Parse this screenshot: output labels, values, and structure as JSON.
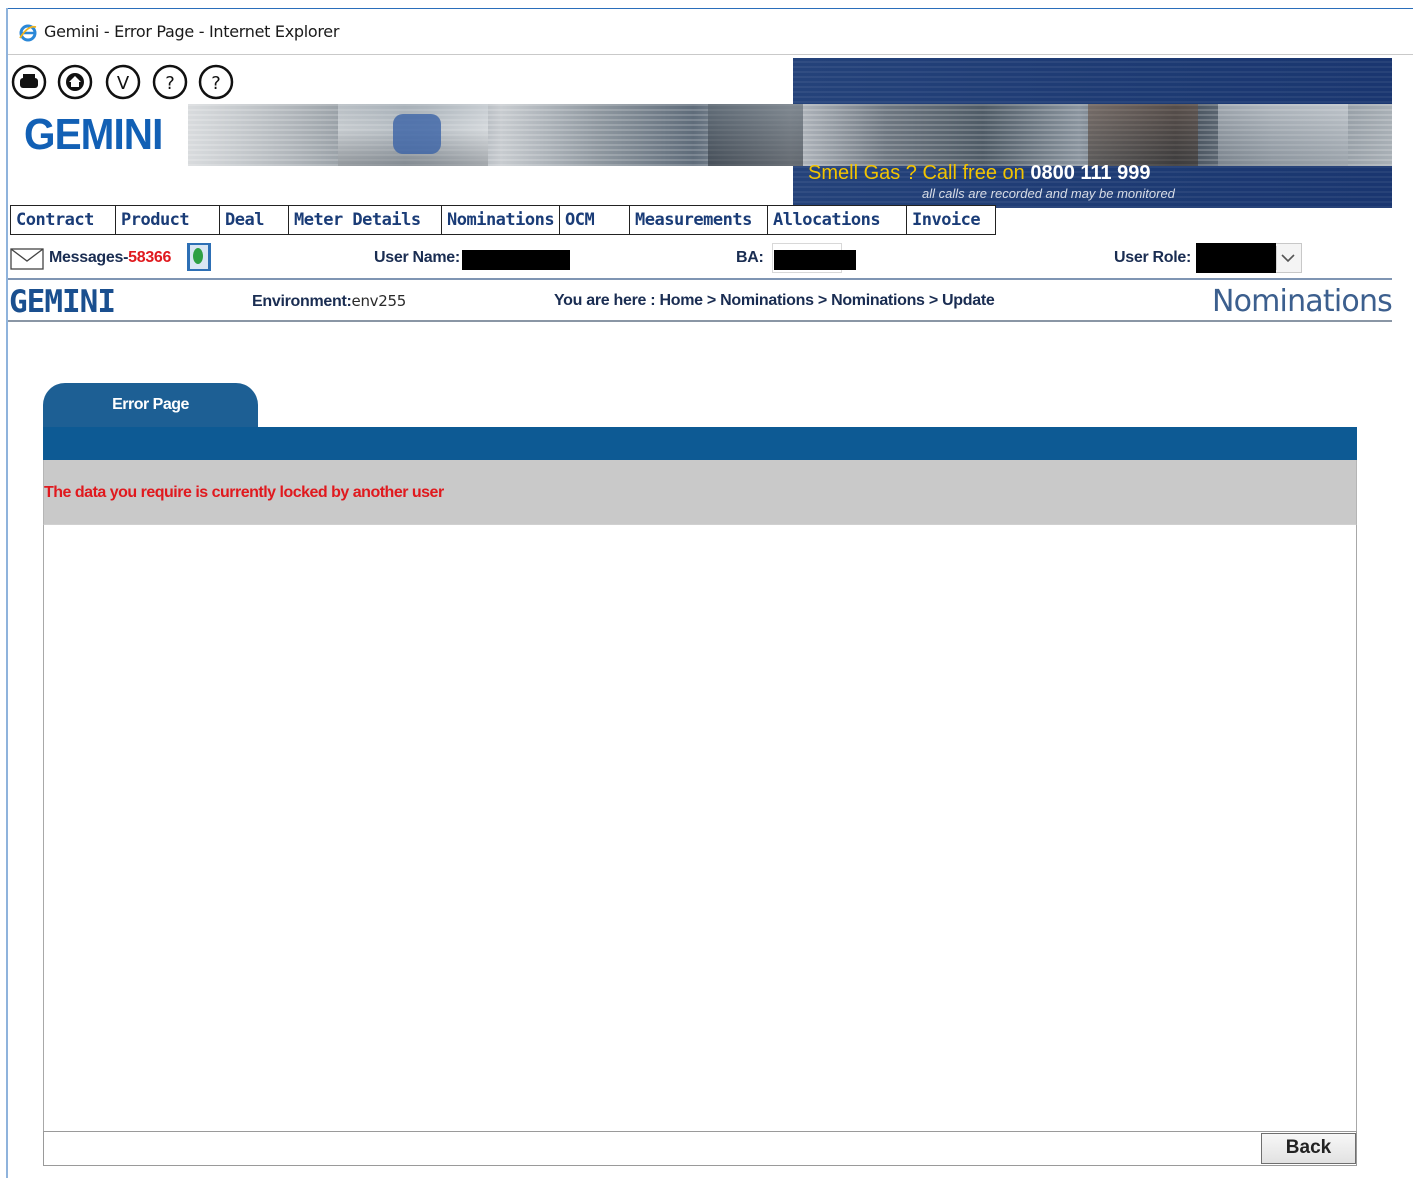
{
  "window": {
    "title": "Gemini - Error Page - Internet Explorer"
  },
  "header": {
    "logo_text": "GEMINI",
    "banner": {
      "smell_gas": "Smell Gas ? Call free on",
      "phone": "0800 111 999",
      "recorded_notice": "all calls are recorded and may be monitored"
    },
    "toolbar_icons": [
      "print-icon",
      "home-icon",
      "version-icon",
      "help-icon",
      "help-icon"
    ]
  },
  "main_nav": {
    "items": [
      {
        "label": "Contract"
      },
      {
        "label": "Product"
      },
      {
        "label": "Deal"
      },
      {
        "label": "Meter Details"
      },
      {
        "label": "Nominations"
      },
      {
        "label": "OCM"
      },
      {
        "label": "Measurements"
      },
      {
        "label": "Allocations"
      },
      {
        "label": "Invoice"
      }
    ]
  },
  "user_bar": {
    "messages_label": "Messages-",
    "messages_count": "58366",
    "user_name_label": "User Name:",
    "ba_label": "BA:",
    "user_role_label": "User Role:"
  },
  "context_bar": {
    "logo_small": "GEMINI",
    "environment_label": "Environment:",
    "environment_value": "env255",
    "breadcrumb_prefix": "You are here :",
    "breadcrumb": [
      "Home",
      "Nominations",
      "Nominations",
      "Update"
    ],
    "breadcrumb_separator": ">",
    "page_heading": "Nominations"
  },
  "error_panel": {
    "tab_label": "Error Page",
    "message": "The data you require is currently locked by another user",
    "back_label": "Back"
  },
  "colors": {
    "brand_blue": "#1260b5",
    "tab_blue": "#1d5f94",
    "error_red": "#e0191e",
    "banner_yellow": "#f3c400"
  }
}
